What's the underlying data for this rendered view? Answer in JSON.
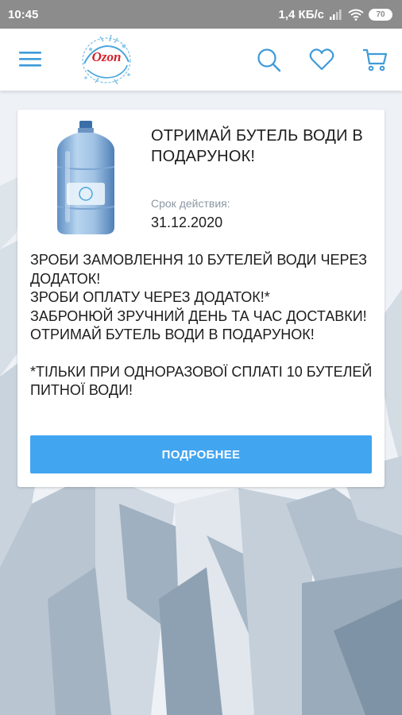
{
  "status_bar": {
    "time": "10:45",
    "network_speed": "1,4 КБ/с",
    "battery": "70"
  },
  "header": {
    "logo_text": "Ozon",
    "icons": [
      "menu-icon",
      "search-icon",
      "heart-icon",
      "cart-icon"
    ],
    "accent_color": "#3e9bd8"
  },
  "promo": {
    "title": "ОТРИМАЙ БУТЕЛЬ ВОДИ В ПОДАРУНОК!",
    "validity_label": "Срок действия:",
    "validity_date": "31.12.2020",
    "body_lines": [
      "ЗРОБИ ЗАМОВЛЕННЯ 10 БУТЕЛЕЙ ВОДИ ЧЕРЕЗ ДОДАТОК!",
      "ЗРОБИ ОПЛАТУ ЧЕРЕЗ ДОДАТОК!*",
      "ЗАБРОНЮЙ ЗРУЧНИЙ ДЕНЬ ТА ЧАС ДОСТАВКИ!",
      "ОТРИМАЙ БУТЕЛЬ ВОДИ В ПОДАРУНОК!"
    ],
    "footnote": "*ТІЛЬКИ ПРИ ОДНОРАЗОВОЇ СПЛАТІ 10 БУТЕЛЕЙ ПИТНОЇ ВОДИ!",
    "button_label": "ПОДРОБНЕЕ",
    "button_color": "#42a5f0"
  }
}
